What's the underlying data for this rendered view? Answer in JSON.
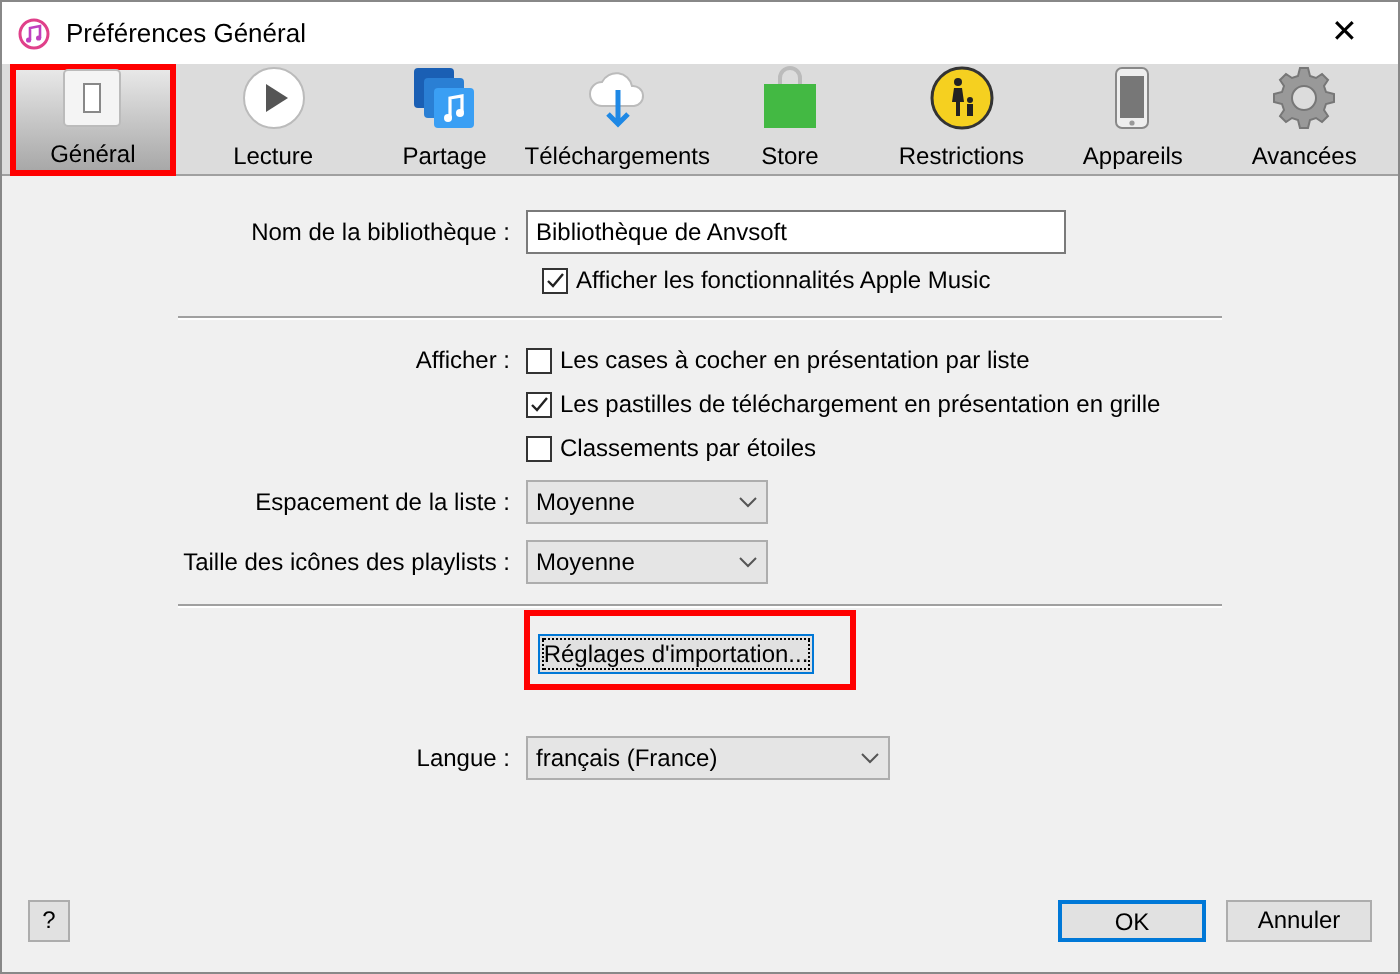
{
  "window": {
    "title": "Préférences Général",
    "close": "✕"
  },
  "tabs": [
    {
      "label": "Général",
      "kind": "general",
      "selected": true
    },
    {
      "label": "Lecture",
      "kind": "play",
      "selected": false
    },
    {
      "label": "Partage",
      "kind": "share",
      "selected": false
    },
    {
      "label": "Téléchargements",
      "kind": "download",
      "selected": false
    },
    {
      "label": "Store",
      "kind": "store",
      "selected": false
    },
    {
      "label": "Restrictions",
      "kind": "restrict",
      "selected": false
    },
    {
      "label": "Appareils",
      "kind": "device",
      "selected": false
    },
    {
      "label": "Avancées",
      "kind": "advanced",
      "selected": false
    }
  ],
  "library": {
    "label": "Nom de la bibliothèque :",
    "value": "Bibliothèque de Anvsoft",
    "apple_music": {
      "label": "Afficher les fonctionnalités Apple Music",
      "checked": true
    }
  },
  "display": {
    "label": "Afficher :",
    "options": [
      {
        "label": "Les cases à cocher en présentation par liste",
        "checked": false
      },
      {
        "label": "Les pastilles de téléchargement en présentation en grille",
        "checked": true
      },
      {
        "label": "Classements par étoiles",
        "checked": false
      }
    ]
  },
  "selects": [
    {
      "label": "Espacement de la liste :",
      "value": "Moyenne"
    },
    {
      "label": "Taille des icônes des playlists :",
      "value": "Moyenne"
    }
  ],
  "import_button": {
    "label": "Réglages d'importation...",
    "highlighted": true
  },
  "language": {
    "label": "Langue :",
    "value": "français (France)"
  },
  "footer": {
    "help": "?",
    "ok": "OK",
    "cancel": "Annuler"
  }
}
